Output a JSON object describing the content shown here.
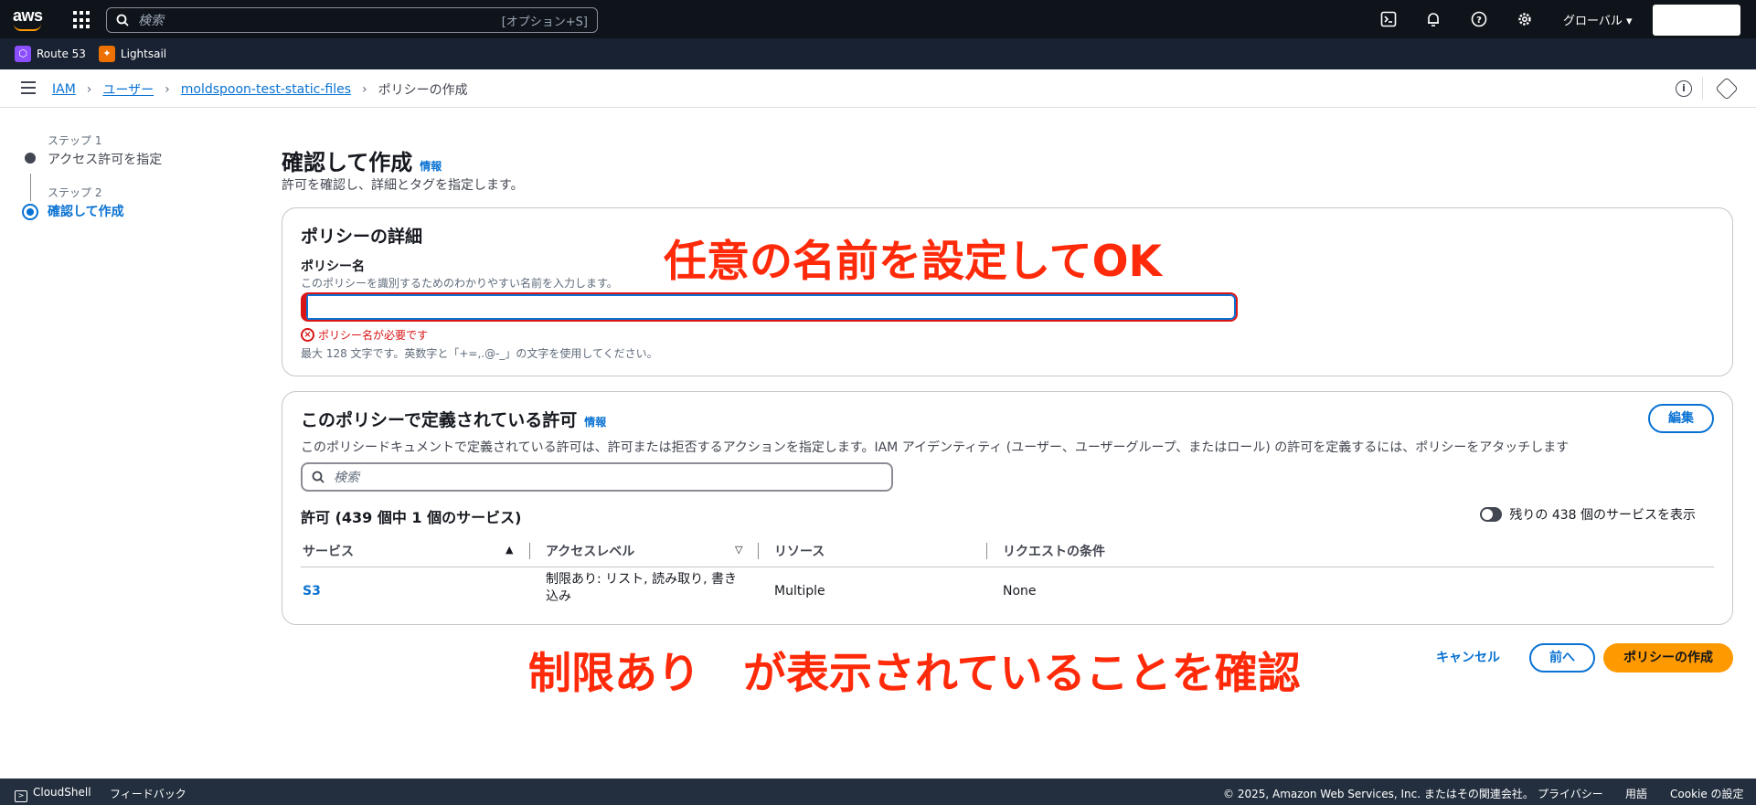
{
  "topnav": {
    "logo_text": "aws",
    "search_placeholder": "検索",
    "search_shortcut": "[オプション+S]",
    "region": "グローバル ▾",
    "icons": [
      "cloudshell-icon",
      "bell-icon",
      "help-icon",
      "gear-icon"
    ]
  },
  "favorites": [
    {
      "label": "Route 53",
      "color": "#8c4fff"
    },
    {
      "label": "Lightsail",
      "color": "#ed7100"
    }
  ],
  "breadcrumb": {
    "items": [
      "IAM",
      "ユーザー",
      "moldspoon-test-static-files"
    ],
    "current": "ポリシーの作成"
  },
  "steps": [
    {
      "label": "ステップ 1",
      "name": "アクセス許可を指定"
    },
    {
      "label": "ステップ 2",
      "name": "確認して作成"
    }
  ],
  "header": {
    "title": "確認して作成",
    "info": "情報",
    "description": "許可を確認し、詳細とタグを指定します。"
  },
  "details": {
    "title": "ポリシーの詳細",
    "field_label": "ポリシー名",
    "field_desc": "このポリシーを識別するためのわかりやすい名前を入力します。",
    "field_value": "",
    "error": "ポリシー名が必要です",
    "constraint": "最大 128 文字です。英数字と「+=,.@-_」の文字を使用してください。"
  },
  "permissions": {
    "title": "このポリシーで定義されている許可",
    "info": "情報",
    "edit": "編集",
    "description": "このポリシードキュメントで定義されている許可は、許可または拒否するアクションを指定します。IAM アイデンティティ (ユーザー、ユーザーグループ、またはロール) の許可を定義するには、ポリシーをアタッチします",
    "search_placeholder": "検索",
    "count_title": "許可 (439 個中 1 個のサービス)",
    "toggle_label": "残りの 438 個のサービスを表示",
    "columns": [
      "サービス",
      "アクセスレベル",
      "リソース",
      "リクエストの条件"
    ],
    "rows": [
      {
        "service": "S3",
        "access_line1": "制限あり: リスト, 読み取り, 書き",
        "access_line2": "込み",
        "resource": "Multiple",
        "condition": "None"
      }
    ]
  },
  "annotations": {
    "top": "任意の名前を設定してOK",
    "bottom": "制限あり　が表示されていることを確認"
  },
  "actions": {
    "cancel": "キャンセル",
    "prev": "前へ",
    "create": "ポリシーの作成"
  },
  "footer": {
    "cloudshell": "CloudShell",
    "feedback": "フィードバック",
    "copyright": "© 2025, Amazon Web Services, Inc. またはその関連会社。",
    "privacy": "プライバシー",
    "terms": "用語",
    "cookie": "Cookie の設定"
  }
}
